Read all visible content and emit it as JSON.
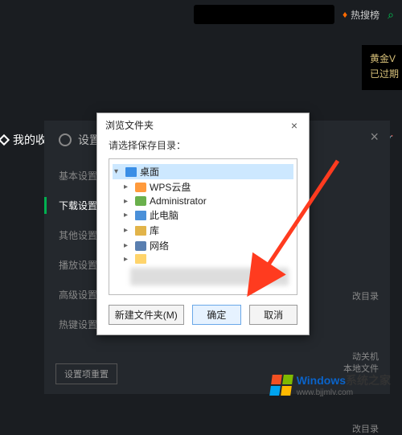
{
  "topbar": {
    "hot": "热搜榜"
  },
  "vip": {
    "line1": "黄金V",
    "line2": "已过期"
  },
  "left_tab": "我的收",
  "settings": {
    "title": "设置",
    "nav": [
      "基本设置",
      "下载设置",
      "其他设置",
      "播放设置",
      "高级设置",
      "热键设置"
    ],
    "active_index": 1,
    "reset": "设置项重置",
    "right_snips": [
      "改目录",
      "动关机",
      "本地文件",
      "改目录"
    ]
  },
  "dialog": {
    "title": "浏览文件夹",
    "label": "请选择保存目录：",
    "tree": [
      {
        "label": "桌面",
        "icon": "desktop",
        "expanded": true,
        "selected": true,
        "depth": 0
      },
      {
        "label": "WPS云盘",
        "icon": "cloud",
        "depth": 1,
        "expandable": true
      },
      {
        "label": "Administrator",
        "icon": "user",
        "depth": 1,
        "expandable": true
      },
      {
        "label": "此电脑",
        "icon": "pc",
        "depth": 1,
        "expandable": true
      },
      {
        "label": "库",
        "icon": "lib",
        "depth": 1,
        "expandable": true
      },
      {
        "label": "网络",
        "icon": "net",
        "depth": 1,
        "expandable": true
      },
      {
        "label": "",
        "icon": "fold",
        "depth": 1,
        "expandable": true,
        "blurred": true
      }
    ],
    "new_folder": "新建文件夹(M)",
    "ok": "确定",
    "cancel": "取消"
  },
  "watermark": {
    "brand": "Windows",
    "sub": "系统之家",
    "url": "www.bjjmlv.com"
  }
}
